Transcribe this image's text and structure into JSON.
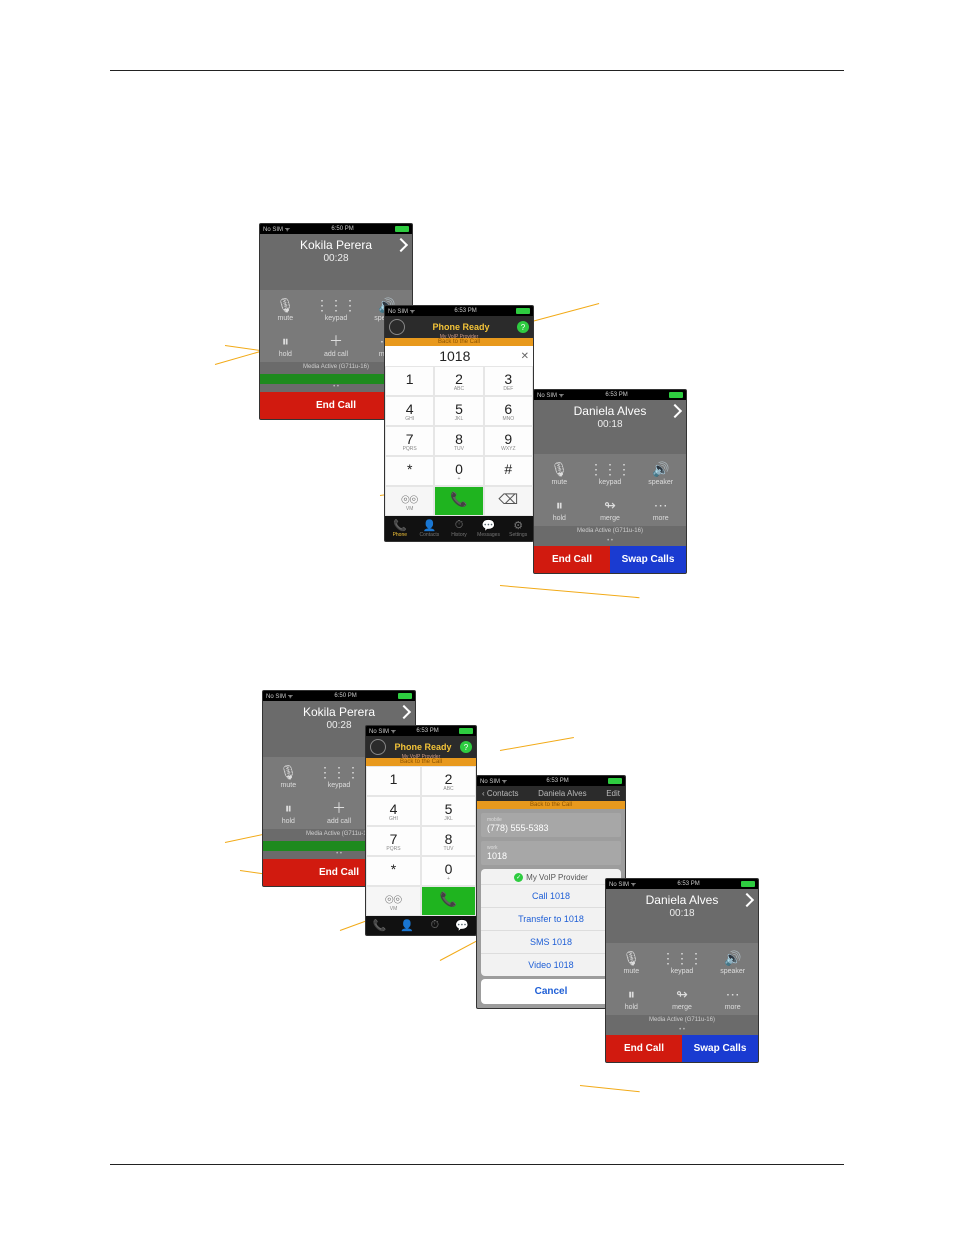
{
  "statusbar": {
    "left": "No SIM  ᯤ",
    "time1": "6:50 PM",
    "time2": "6:53 PM"
  },
  "callA": {
    "name": "Kokila Perera",
    "timer": "00:28",
    "row1": [
      "mute",
      "keypad",
      "speaker"
    ],
    "row2": [
      "hold",
      "add call",
      "more"
    ],
    "media": "Media Active (G711u-16)",
    "end": "End Call"
  },
  "dialer": {
    "title": "Phone Ready",
    "provider": "My VoIP Provider",
    "banner": "Back to the Call",
    "number": "1018",
    "keys": [
      [
        "1",
        ""
      ],
      [
        "2",
        "ABC"
      ],
      [
        "3",
        "DEF"
      ],
      [
        "4",
        "GHI"
      ],
      [
        "5",
        "JKL"
      ],
      [
        "6",
        "MNO"
      ],
      [
        "7",
        "PQRS"
      ],
      [
        "8",
        "TUV"
      ],
      [
        "9",
        "WXYZ"
      ],
      [
        "*",
        ""
      ],
      [
        "0",
        "+"
      ],
      [
        "#",
        ""
      ]
    ],
    "vm": "VM",
    "nav": [
      "Phone",
      "Contacts",
      "History",
      "Messages",
      "Settings"
    ]
  },
  "callB": {
    "name": "Daniela Alves",
    "timer": "00:18",
    "row1": [
      "mute",
      "keypad",
      "speaker"
    ],
    "row2": [
      "hold",
      "merge",
      "more"
    ],
    "media": "Media Active (G711u-16)",
    "end": "End Call",
    "swap": "Swap Calls"
  },
  "contactSheet": {
    "back": "Contacts",
    "title": "Daniela Alves",
    "edit": "Edit",
    "banner": "Back to the Call",
    "mobile_label": "mobile",
    "mobile": "(778) 555-5383",
    "work_label": "work",
    "work": "1018",
    "sheet_provider": "My VoIP Provider",
    "opts": [
      "Call 1018",
      "Transfer to 1018",
      "SMS 1018",
      "Video 1018"
    ],
    "cancel": "Cancel"
  }
}
